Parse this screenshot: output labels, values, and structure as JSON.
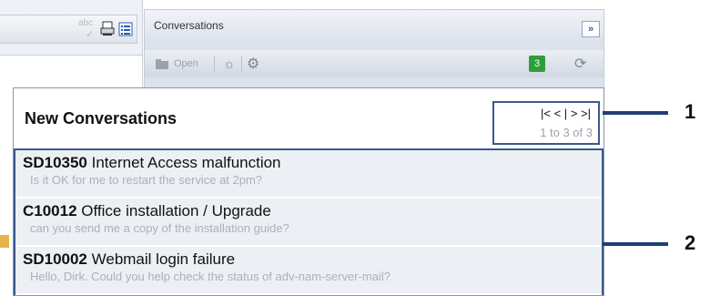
{
  "left_toolbar": {
    "spell_glyph": "abc",
    "spell_icon": "spell-check-icon",
    "print_icon": "print-icon",
    "list_icon": "list-view-icon"
  },
  "conversations": {
    "title": "Conversations",
    "expand_label": "»",
    "toolbar": {
      "open_label": "Open",
      "count_badge": "3",
      "badge_color": "#2e9e3a"
    }
  },
  "popup": {
    "title": "New Conversations",
    "pager": {
      "first": "|<",
      "prev": "<",
      "sep": "|",
      "next": ">",
      "last": ">|",
      "range": "1 to 3 of 3"
    },
    "items": [
      {
        "id": "SD10350",
        "subject": "Internet Access malfunction",
        "preview": "Is it OK for me to restart the service at 2pm?"
      },
      {
        "id": "C10012",
        "subject": "Office installation / Upgrade",
        "preview": "can you send me a copy of the installation guide?"
      },
      {
        "id": "SD10002",
        "subject": "Webmail login failure",
        "preview": "Hello, Dirk. Could you help check the status of adv-nam-server-mail?"
      }
    ]
  },
  "callouts": [
    "1",
    "2"
  ],
  "accent_color": "#3a5a8f"
}
